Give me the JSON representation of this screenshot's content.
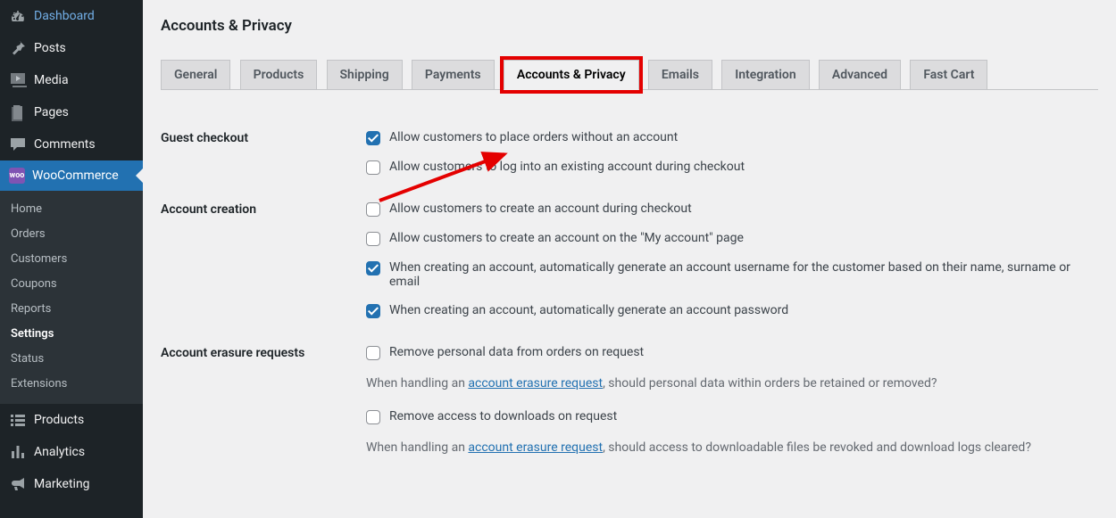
{
  "sidebar": {
    "top": [
      {
        "label": "Dashboard",
        "icon": "dashboard"
      },
      {
        "label": "Posts",
        "icon": "pin"
      },
      {
        "label": "Media",
        "icon": "media"
      },
      {
        "label": "Pages",
        "icon": "pages"
      },
      {
        "label": "Comments",
        "icon": "comments"
      }
    ],
    "woo_label": "WooCommerce",
    "woo_sub": [
      {
        "label": "Home"
      },
      {
        "label": "Orders"
      },
      {
        "label": "Customers"
      },
      {
        "label": "Coupons"
      },
      {
        "label": "Reports"
      },
      {
        "label": "Settings",
        "current": true
      },
      {
        "label": "Status"
      },
      {
        "label": "Extensions"
      }
    ],
    "bottom": [
      {
        "label": "Products",
        "icon": "products"
      },
      {
        "label": "Analytics",
        "icon": "analytics"
      },
      {
        "label": "Marketing",
        "icon": "marketing"
      }
    ]
  },
  "page_title": "Accounts & Privacy",
  "tabs": [
    {
      "label": "General"
    },
    {
      "label": "Products"
    },
    {
      "label": "Shipping"
    },
    {
      "label": "Payments"
    },
    {
      "label": "Accounts & Privacy",
      "active": true
    },
    {
      "label": "Emails"
    },
    {
      "label": "Integration"
    },
    {
      "label": "Advanced"
    },
    {
      "label": "Fast Cart"
    }
  ],
  "sections": {
    "guest": {
      "heading": "Guest checkout",
      "opt1": {
        "label": "Allow customers to place orders without an account",
        "checked": true
      },
      "opt2": {
        "label": "Allow customers to log into an existing account during checkout",
        "checked": false
      }
    },
    "creation": {
      "heading": "Account creation",
      "opt1": {
        "label": "Allow customers to create an account during checkout",
        "checked": false
      },
      "opt2": {
        "label": "Allow customers to create an account on the \"My account\" page",
        "checked": false
      },
      "opt3": {
        "label": "When creating an account, automatically generate an account username for the customer based on their name, surname or email",
        "checked": true
      },
      "opt4": {
        "label": "When creating an account, automatically generate an account password",
        "checked": true
      }
    },
    "erasure": {
      "heading": "Account erasure requests",
      "opt1": {
        "label": "Remove personal data from orders on request",
        "checked": false
      },
      "desc1_pre": "When handling an ",
      "desc1_link": "account erasure request",
      "desc1_post": ", should personal data within orders be retained or removed?",
      "opt2": {
        "label": "Remove access to downloads on request",
        "checked": false
      },
      "desc2_pre": "When handling an ",
      "desc2_link": "account erasure request",
      "desc2_post": ", should access to downloadable files be revoked and download logs cleared?"
    }
  }
}
